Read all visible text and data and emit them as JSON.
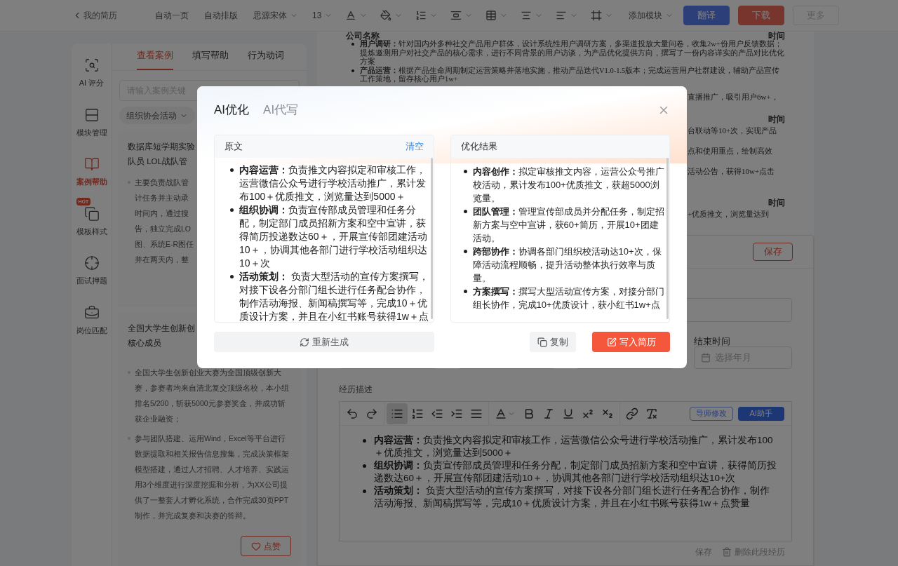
{
  "toolbar": {
    "back": "我的简历",
    "actions": [
      "自动一页",
      "自动排版"
    ],
    "font": "思源宋体",
    "font_size": "13",
    "add_module": "添加模块",
    "buttons": [
      {
        "label": "翻译",
        "kind": "primary"
      },
      {
        "label": "下载",
        "kind": "danger"
      },
      {
        "label": "更多",
        "kind": "outline"
      }
    ]
  },
  "rail": [
    {
      "label": "AI 评分",
      "kind": "score",
      "selected": false
    },
    {
      "label": "模块管理",
      "kind": "modules",
      "selected": false
    },
    {
      "label": "案例帮助",
      "kind": "cases",
      "selected": true
    },
    {
      "label": "模板样式",
      "kind": "templates",
      "selected": false,
      "badge": "HOT"
    },
    {
      "label": "面试押题",
      "kind": "interview",
      "selected": false
    },
    {
      "label": "岗位匹配",
      "kind": "jobs",
      "selected": false
    }
  ],
  "case_panel": {
    "tabs": [
      {
        "label": "查看案例",
        "selected": true
      },
      {
        "label": "填写帮助",
        "selected": false
      },
      {
        "label": "行为动词",
        "selected": false
      }
    ],
    "search": {
      "placeholder": "请输入案例关键"
    },
    "filter": "组织协会活动",
    "cards": [
      {
        "title_lines": [
          "数据库短学期实验",
          "队员 LOL战队管"
        ],
        "bullets": [
          {
            "lines": [
              "主要负责战队管",
              "计任务并主动承",
              "时间内，通过搜",
              "告，独立完成LO",
              "图、系统E-R图任",
              "并在两天内，整"
            ]
          }
        ]
      },
      {
        "title_lines": [
          "全国大学生创新创",
          "核心成员"
        ],
        "bullets": [
          {
            "text": "全国大学生创新创业大赛为全国顶级创新大赛，参赛者均来自清北复交顶级名校，本小组排名5/200，斩获5000元参赛奖金，并成功斩获企业融资；"
          },
          {
            "text": "参与团队搭建、运用Wind，Excel等平台进行数据提取和相关报告信息搜集，完成决策框架模型搭建，通过人才招聘、人才培养、实践运用3个维度进行深度挖掘和分析，为XX公司提供了一整套人才孵化系统，合作完成30页PPT制作，并完成复赛和决赛的答辩。"
          }
        ],
        "like": "点赞"
      }
    ]
  },
  "resume_preview": {
    "heading": "公司名称",
    "time": "时间",
    "bullets": [
      {
        "head": "用户调研：",
        "body": "针对国内外多种社交产品用户群体，设计系统性用户调研方案，多渠道投放大量问卷，收集2w+份用户反馈数据；提炼邀测用户对社交产品的核心需求，进行不同背景的用户访谈，为产品优化提供方向，撰写了一份内容详实的产品对比优化方案"
      },
      {
        "head": "产品运营：",
        "body": "根据产品生命周期制定运营策略并落地实施，推动产品迭代V1.0-1.5版本；完成运营用户社群建设，辅助产品宣传工作策地，留存核心用户1w+"
      }
    ],
    "fragment_groups": [
      [
        {
          "kind": "text",
          "text": "直播推广，吸引用户6w+，"
        },
        {
          "kind": "time",
          "text": "时间"
        },
        {
          "kind": "text",
          "text": "台联动等10+次，实现产品"
        },
        {
          "kind": "text",
          "text": "点和使用重点，绘制高效"
        },
        {
          "kind": "text",
          "text": "活动公告，获得10w+点击"
        }
      ],
      [
        {
          "kind": "time",
          "text": "时间"
        },
        {
          "kind": "text",
          "text": "+优质推文，浏览量达到"
        }
      ]
    ]
  },
  "editor": {
    "save": "保存",
    "end_label": "结束时间",
    "date_placeholder": "选择年月",
    "desc_label": "经历描述",
    "bullet_list_on": true,
    "mentor": "导师修改",
    "ai": "AI助手",
    "items": [
      {
        "head": "内容运营：",
        "body": "负责推文内容拟定和审核工作，运营微信公众号进行学校活动推广，累计发布100 ＋优质推文，浏览量达到5000＋"
      },
      {
        "head": "组织协调：",
        "body": "负责宣传部成员管理和任务分配，制定部门成员招新方案和空中宣讲，获得简历投递数达60＋，开展宣传部团建活动10＋，协调其他各部门进行学校活动组织达10+次"
      },
      {
        "head": "活动策划：",
        "body": " 负责大型活动的宣传方案撰写，对接下设各分部门组长进行任务配合协作，制作活动海报、新闻稿撰写等，完成10＋优质设计方案，并且在小红书账号获得1w＋点赞量"
      }
    ],
    "footer_save": "保存",
    "footer_delete": "删除此段经历"
  },
  "modal": {
    "tabs": [
      {
        "label": "AI优化",
        "selected": true
      },
      {
        "label": "AI代写",
        "selected": false
      }
    ],
    "original": {
      "title": "原文",
      "clear": "清空",
      "items": [
        {
          "head": "内容运营：",
          "body": "负责推文内容拟定和审核工作，运营微信公众号进行学校活动推广，累计发布100＋优质推文，浏览量达到5000＋"
        },
        {
          "head": "组织协调：",
          "body": "负责宣传部成员管理和任务分配，制定部门成员招新方案和空中宣讲，获得简历投递数达60＋，开展宣传部团建活动10＋，协调其他各部门进行学校活动组织达10＋次"
        },
        {
          "head": "活动策划：",
          "body": " 负责大型活动的宣传方案撰写，对接下设各分部门组长进行任务配合协作，制作活动海报、新闻稿撰写等，完成10＋优质设计方案，并且在小红书账号获得1w＋点"
        }
      ]
    },
    "result": {
      "title": "优化结果",
      "items": [
        {
          "head": "内容创作：",
          "body": "拟定审核推文内容，运营公众号推广校活动，累计发布100+优质推文，获超5000浏览量。"
        },
        {
          "head": "团队管理：",
          "body": "管理宣传部成员并分配任务，制定招新方案与空中宣讲，获60+简历，开展10+团建活动。"
        },
        {
          "head": "跨部协作：",
          "body": "协调各部门组织校活动达10+次，保障活动流程顺畅，提升活动整体执行效率与质量。"
        },
        {
          "head": "方案撰写：",
          "body": "撰写大型活动宣传方案，对接分部门组长协作，完成10+优质设计，获小红书1w+点"
        }
      ]
    },
    "regenerate": "重新生成",
    "copy": "复制",
    "write": "写入简历"
  }
}
